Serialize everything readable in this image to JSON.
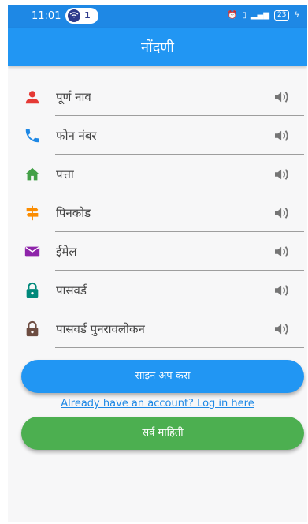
{
  "status_bar": {
    "time": "11:01",
    "notification_count": "1",
    "battery": "23"
  },
  "app_bar": {
    "title": "नोंदणी"
  },
  "fields": [
    {
      "label": "पूर्ण नाव",
      "icon": "person-icon",
      "color": "#e53935"
    },
    {
      "label": "फोन नंबर",
      "icon": "phone-icon",
      "color": "#1e88e5"
    },
    {
      "label": "पत्ता",
      "icon": "home-icon",
      "color": "#43a047"
    },
    {
      "label": "पिनकोड",
      "icon": "signpost-icon",
      "color": "#fb8c00"
    },
    {
      "label": "ईमेल",
      "icon": "mail-icon",
      "color": "#8e24aa"
    },
    {
      "label": "पासवर्ड",
      "icon": "lock-icon",
      "color": "#00897b"
    },
    {
      "label": "पासवर्ड पुनरावलोकन",
      "icon": "lock-icon",
      "color": "#6d4c41"
    }
  ],
  "buttons": {
    "signup": "साइन अप करा",
    "all_info": "सर्व माहिती"
  },
  "login_link": "Already have an account? Log in here",
  "colors": {
    "primary": "#2196f3",
    "secondary": "#4caf50",
    "speaker": "#757575"
  }
}
